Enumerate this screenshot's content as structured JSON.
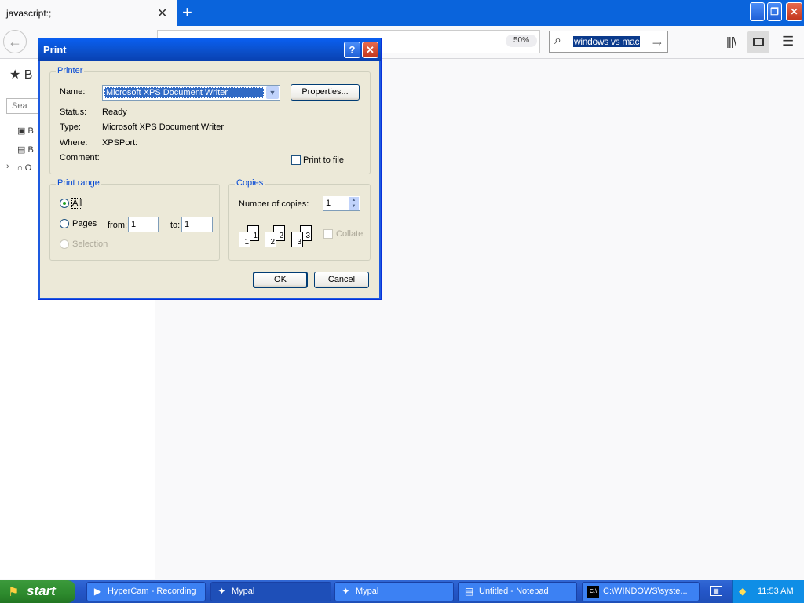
{
  "browser": {
    "tab_title": "javascript:;",
    "zoom": "50%",
    "search_value": "windows vs mac",
    "sidebar": {
      "title": "B",
      "search_placeholder": "Sea",
      "items": [
        "B",
        "B",
        "O"
      ]
    }
  },
  "dialog": {
    "title": "Print",
    "printer": {
      "group_label": "Printer",
      "name_label": "Name:",
      "name_value": "Microsoft XPS Document Writer",
      "properties_label": "Properties...",
      "status_label": "Status:",
      "status_value": "Ready",
      "type_label": "Type:",
      "type_value": "Microsoft XPS Document Writer",
      "where_label": "Where:",
      "where_value": "XPSPort:",
      "comment_label": "Comment:",
      "print_to_file_label": "Print to file"
    },
    "range": {
      "group_label": "Print range",
      "all_label": "All",
      "pages_label": "Pages",
      "from_label": "from:",
      "from_value": "1",
      "to_label": "to:",
      "to_value": "1",
      "selection_label": "Selection"
    },
    "copies": {
      "group_label": "Copies",
      "number_label": "Number of copies:",
      "number_value": "1",
      "collate_label": "Collate",
      "page_numbers": [
        "1",
        "1",
        "2",
        "2",
        "3",
        "3"
      ]
    },
    "ok_label": "OK",
    "cancel_label": "Cancel"
  },
  "taskbar": {
    "start_label": "start",
    "items": [
      {
        "label": "HyperCam - Recording",
        "icon": "hypercam-icon"
      },
      {
        "label": "Mypal",
        "icon": "mypal-icon"
      },
      {
        "label": "Mypal",
        "icon": "mypal-icon"
      },
      {
        "label": "Untitled - Notepad",
        "icon": "notepad-icon"
      },
      {
        "label": "C:\\WINDOWS\\syste...",
        "icon": "cmd-icon"
      }
    ],
    "clock": "11:53 AM"
  }
}
